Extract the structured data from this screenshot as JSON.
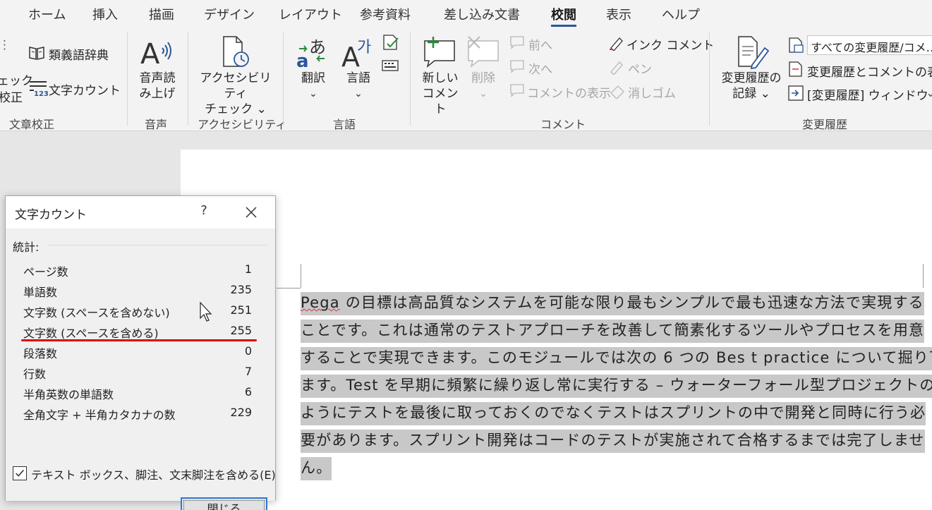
{
  "tabs": [
    "ホーム",
    "挿入",
    "描画",
    "デザイン",
    "レイアウト",
    "参考資料",
    "差し込み文書",
    "校閲",
    "表示",
    "ヘルプ"
  ],
  "active_tab": "校閲",
  "ribbon": {
    "proofing": {
      "check_top": "ェック",
      "check_bottom": "校正",
      "thesaurus": "類義語辞典",
      "word_count": "文字カウント",
      "group": "文章校正"
    },
    "speech": {
      "read_aloud_1": "音声読",
      "read_aloud_2": "み上げ",
      "group": "音声"
    },
    "accessibility": {
      "check_1": "アクセシビリティ",
      "check_2": "チェック ⌄",
      "group": "アクセシビリティ"
    },
    "language": {
      "translate": "翻訳",
      "language": "言語",
      "chev": "⌄",
      "group": "言語"
    },
    "comments": {
      "new_1": "新しい",
      "new_2": "コメント",
      "delete": "削除",
      "delete_chev": "⌄",
      "prev": "前へ",
      "next": "次へ",
      "show": "コメントの表示",
      "ink": "インク コメント",
      "pen": "ペン",
      "eraser": "消しゴム",
      "group": "コメント"
    },
    "tracking": {
      "track_1": "変更履歴の",
      "track_2": "記録 ⌄",
      "markup_combo": "すべての変更履歴/コメ…",
      "show_markup": "変更履歴とコメントの表示",
      "reviewing_pane": "[変更履歴] ウィンドウ",
      "group": "変更履歴"
    }
  },
  "document": {
    "lines": [
      {
        "spell": "Pega",
        "text": " の目標は高品質なシステムを可能な限り最もシンプルで最も迅速な方法で実現する"
      },
      {
        "spell": "",
        "text": "ことです。これは通常のテストアプローチを改善して簡素化するツールやプロセスを用意"
      },
      {
        "spell": "",
        "text": "することで実現できます。このモジュールでは次の 6 つの Bes t practice について掘り下げ"
      },
      {
        "spell": "",
        "text": "ます。Test を早期に頻繁に繰り返し常に実行する – ウォーターフォール型プロジェクトの"
      },
      {
        "spell": "",
        "text": "ようにテストを最後に取っておくのでなくテストはスプリントの中で開発と同時に行う必"
      },
      {
        "spell": "",
        "text": "要があります。スプリント開発はコードのテストが実施されて合格するまでは完了しませ"
      },
      {
        "spell": "",
        "text": "ん。"
      }
    ]
  },
  "dialog": {
    "title": "文字カウント",
    "help": "?",
    "stats_label": "統計:",
    "stats": [
      {
        "label": "ページ数",
        "value": "1"
      },
      {
        "label": "単語数",
        "value": "235"
      },
      {
        "label": "文字数 (スペースを含めない)",
        "value": "251"
      },
      {
        "label": "文字数 (スペースを含める)",
        "value": "255"
      },
      {
        "label": "段落数",
        "value": "0"
      },
      {
        "label": "行数",
        "value": "7"
      },
      {
        "label": "半角英数の単語数",
        "value": "6"
      },
      {
        "label": "全角文字 + 半角カタカナの数",
        "value": "229"
      }
    ],
    "checkbox_label": "テキスト ボックス、脚注、文末脚注を含める(E)",
    "checkbox_checked": true,
    "close_button": "閉じる",
    "highlight_color": "#e00000"
  },
  "colors": {
    "accent": "#2b579a",
    "selection": "#c8c8c8",
    "focus": "#2c7ad6"
  }
}
